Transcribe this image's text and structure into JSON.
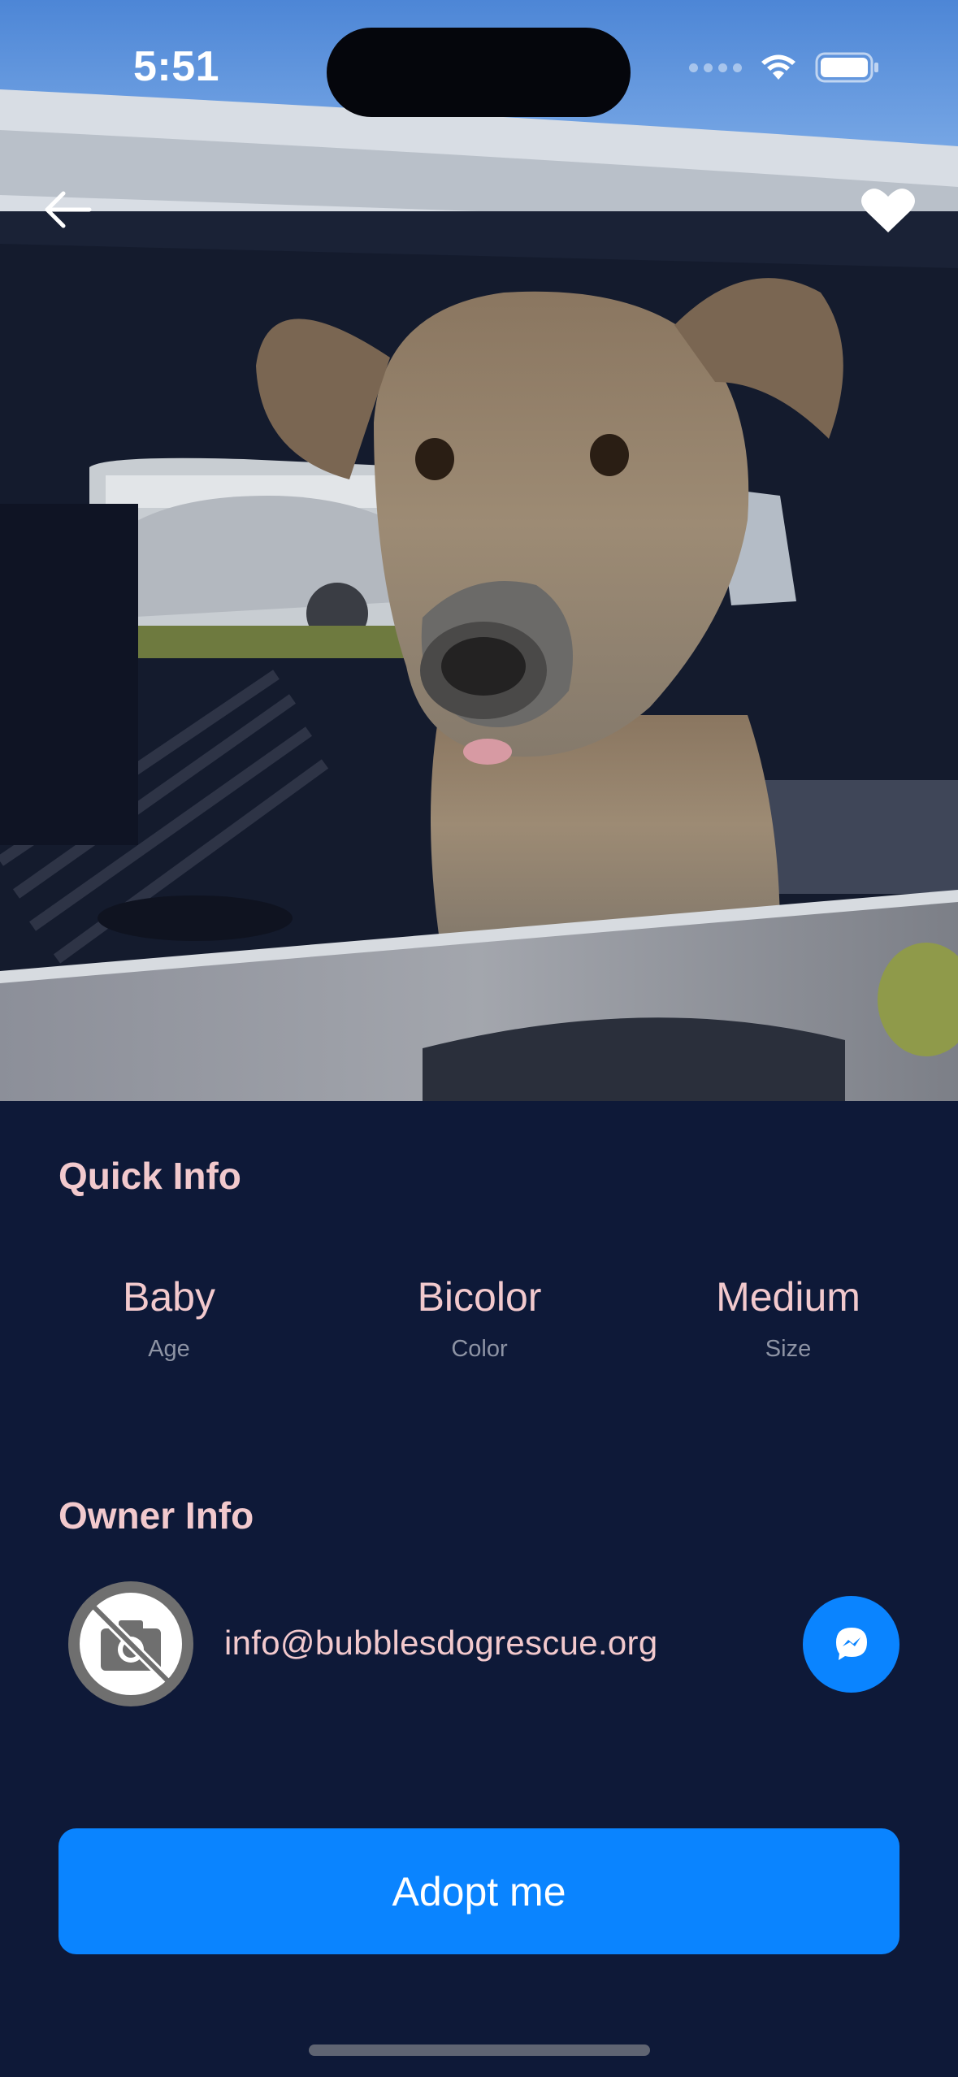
{
  "status_bar": {
    "time": "5:51"
  },
  "nav": {
    "back_icon": "arrow-left-icon",
    "favorite_icon": "heart-icon"
  },
  "quick_info": {
    "title": "Quick Info",
    "items": [
      {
        "value": "Baby",
        "label": "Age"
      },
      {
        "value": "Bicolor",
        "label": "Color"
      },
      {
        "value": "Medium",
        "label": "Size"
      }
    ]
  },
  "owner_info": {
    "title": "Owner Info",
    "email": "info@bubblesdogrescue.org",
    "avatar_icon": "no-photo-camera-icon",
    "message_icon": "messenger-icon"
  },
  "actions": {
    "adopt_label": "Adopt me"
  },
  "colors": {
    "background": "#0e1938",
    "accent": "#0a84ff",
    "heading": "#f2c9cd",
    "muted": "#8d93a4"
  }
}
